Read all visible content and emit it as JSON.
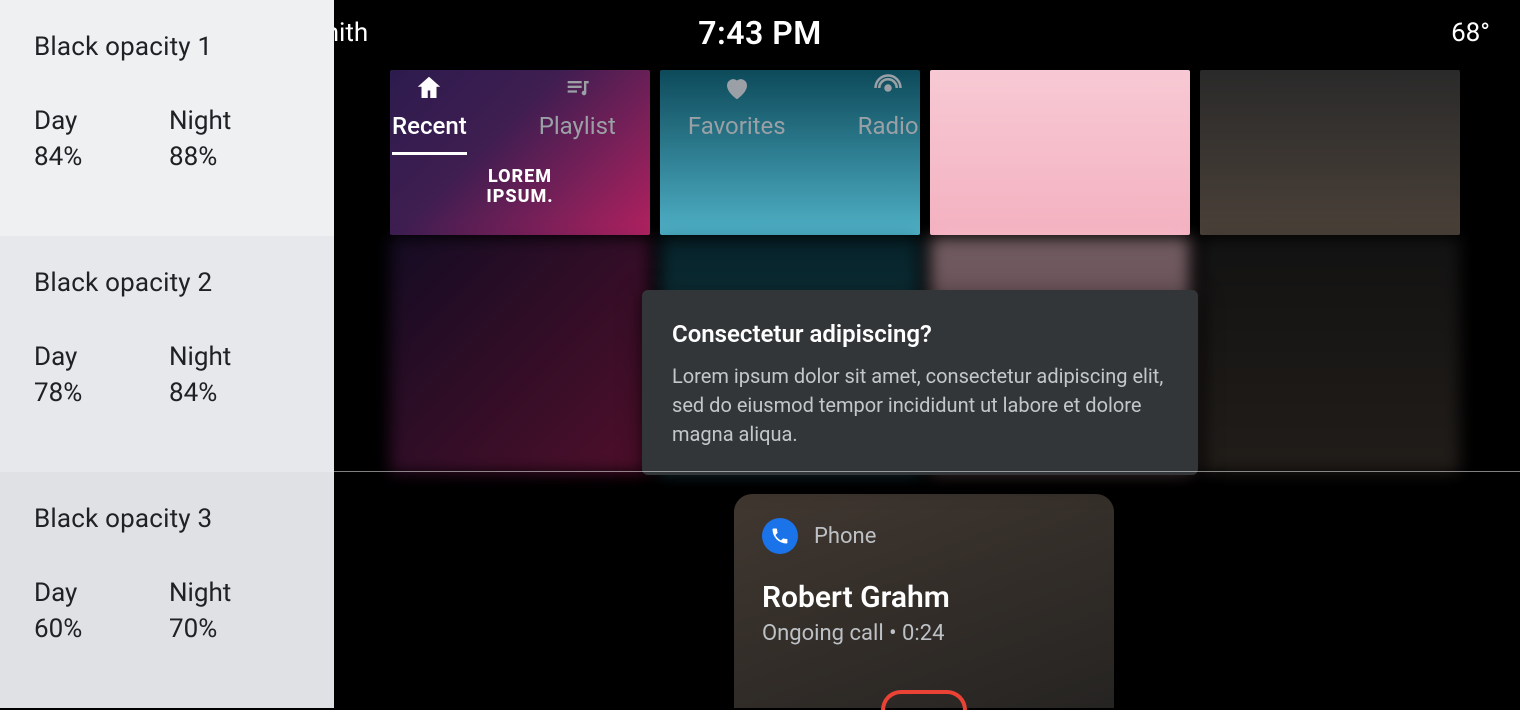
{
  "status_bar": {
    "user_suffix": "n Smith",
    "time": "7:43 PM",
    "temperature": "68°"
  },
  "tabs": [
    {
      "id": "recent",
      "label": "Recent",
      "active": true
    },
    {
      "id": "playlist",
      "label": "Playlist",
      "active": false
    },
    {
      "id": "favorites",
      "label": "Favorites",
      "active": false
    },
    {
      "id": "radio",
      "label": "Radio",
      "active": false
    }
  ],
  "tiles": {
    "lorem_ipsum_label": "LOREM\nIPSUM."
  },
  "dialog": {
    "title": "Consectetur adipiscing?",
    "body": "Lorem ipsum dolor sit amet, consectetur adipiscing elit, sed do eiusmod tempor incididunt ut labore et dolore magna aliqua."
  },
  "phone_card": {
    "app_label": "Phone",
    "caller_name": "Robert Grahm",
    "status_prefix": "Ongoing call",
    "separator": " • ",
    "duration": "0:24"
  },
  "spec_panel": [
    {
      "title": "Black opacity 1",
      "day_label": "Day",
      "day_value": "84%",
      "night_label": "Night",
      "night_value": "88%"
    },
    {
      "title": "Black opacity 2",
      "day_label": "Day",
      "day_value": "78%",
      "night_label": "Night",
      "night_value": "84%"
    },
    {
      "title": "Black opacity 3",
      "day_label": "Day",
      "day_value": "60%",
      "night_label": "Night",
      "night_value": "70%"
    }
  ]
}
